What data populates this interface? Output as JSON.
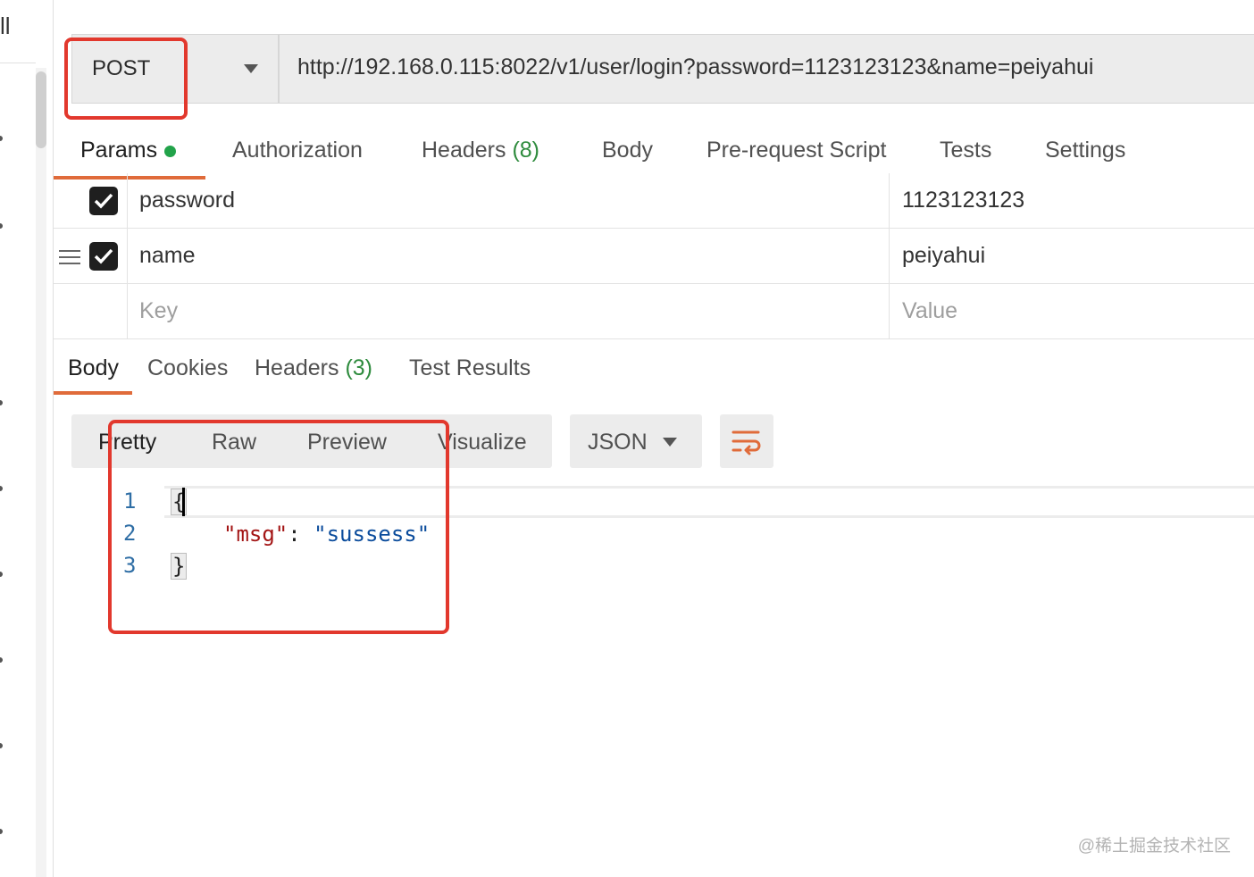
{
  "sidebar": {
    "fragment_text": "ll"
  },
  "request": {
    "method": "POST",
    "url": "http://192.168.0.115:8022/v1/user/login?password=1123123123&name=peiyahui"
  },
  "request_tabs": {
    "params": "Params",
    "authorization": "Authorization",
    "headers": "Headers",
    "headers_count": "(8)",
    "body": "Body",
    "prerequest": "Pre-request Script",
    "tests": "Tests",
    "settings": "Settings"
  },
  "params": {
    "rows": [
      {
        "key": "password",
        "value": "1123123123",
        "checked": true
      },
      {
        "key": "name",
        "value": "peiyahui",
        "checked": true
      }
    ],
    "key_placeholder": "Key",
    "value_placeholder": "Value"
  },
  "response_tabs": {
    "body": "Body",
    "cookies": "Cookies",
    "headers": "Headers",
    "headers_count": "(3)",
    "test_results": "Test Results"
  },
  "body_view": {
    "modes": [
      "Pretty",
      "Raw",
      "Preview",
      "Visualize"
    ],
    "active_mode": "Pretty",
    "format": "JSON"
  },
  "code": {
    "line_numbers": [
      "1",
      "2",
      "3"
    ],
    "open_brace": "{",
    "key": "\"msg\"",
    "colon": ": ",
    "value": "\"sussess\"",
    "close_brace": "}"
  },
  "watermark": "@稀土掘金技术社区",
  "colors": {
    "accent": "#e06b3a",
    "highlight_box": "#e2382d",
    "green": "#2e8b3d"
  }
}
